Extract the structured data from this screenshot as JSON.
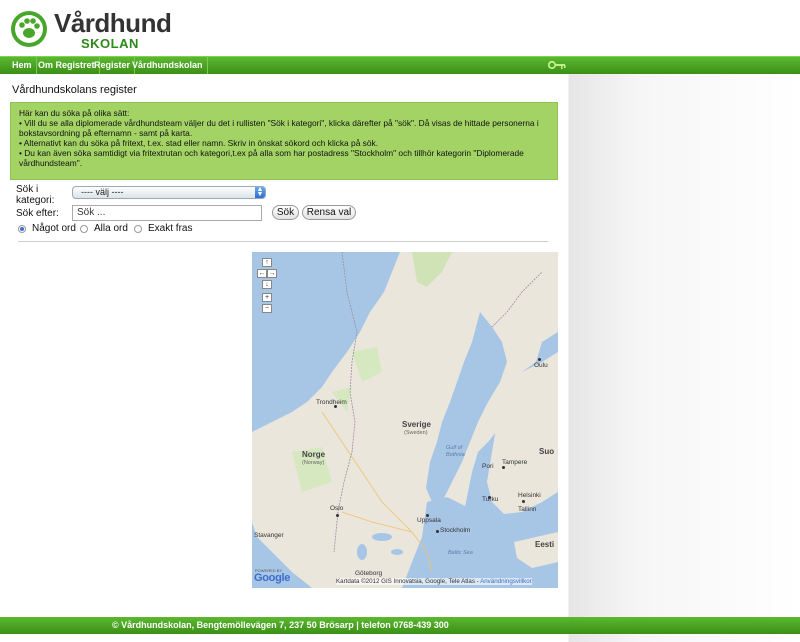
{
  "logo": {
    "title": "Vårdhund",
    "subtitle": "SKOLAN"
  },
  "nav": {
    "items": [
      "Hem",
      "Om Registret",
      "Register",
      "Vårdhundskolan"
    ]
  },
  "page": {
    "title": "Vårdhundskolans register",
    "info_lines": [
      "Här kan du söka på olika sätt:",
      "• Vill du se alla diplomerade vårdhundsteam väljer du det i rullisten \"Sök i kategori\", klicka därefter på \"sök\". Då visas de hittade personerna i bokstavsordning på efternamn - samt på karta.",
      "• Alternativt kan du söka på fritext, t.ex. stad eller namn. Skriv in önskat sökord och klicka på sök.",
      "• Du kan även söka samtidigt via fritextrutan och kategori,t.ex på alla som har postadress \"Stockholm\" och tillhör kategorin \"Diplomerade vårdhundsteam\"."
    ]
  },
  "search": {
    "category_label_1": "Sök i",
    "category_label_2": "kategori:",
    "category_value": "---- välj ----",
    "search_label": "Sök efter:",
    "search_value": "Sök ...",
    "search_button": "Sök",
    "reset_button": "Rensa val",
    "radio_options": [
      "Något ord",
      "Alla ord",
      "Exakt fras"
    ],
    "radio_selected": "Något ord"
  },
  "map": {
    "controls": {
      "up": "↑",
      "left": "←",
      "right": "→",
      "down": "↓",
      "zoom_in": "+",
      "zoom_out": "−"
    },
    "labels": {
      "sverige": "Sverige",
      "sweden": "(Sweden)",
      "norge": "Norge",
      "norway": "(Norway)",
      "suomi": "Suo",
      "eesti": "Eesti",
      "trondheim": "Trondheim",
      "oslo": "Oslo",
      "stavanger": "Stavanger",
      "goteborg": "Göteborg",
      "uppsala": "Uppsala",
      "stockholm": "Stockholm",
      "tampere": "Tampere",
      "helsinki": "Helsinki",
      "tallinn": "Tallinn",
      "oulu": "Oulu",
      "turku": "Turku",
      "pori": "Pori",
      "gulf": "Gulf of",
      "bothnia": "Bothnia",
      "baltic": "Baltic Sea"
    },
    "powered_by": "POWERED BY",
    "google": "Google",
    "attribution": "Kartdata ©2012 GIS Innovatsia, Google, Tele Atlas -",
    "terms_link": "Användningsvillkor"
  },
  "footer": {
    "text": "© Vårdhundskolan, Bengtemöllevägen 7, 237 50 Brösarp | telefon 0768-439 300"
  },
  "colors": {
    "brand_green": "#3a8f17",
    "info_green": "#a3d365",
    "water": "#a7c6e6",
    "land": "#eae6dc"
  }
}
